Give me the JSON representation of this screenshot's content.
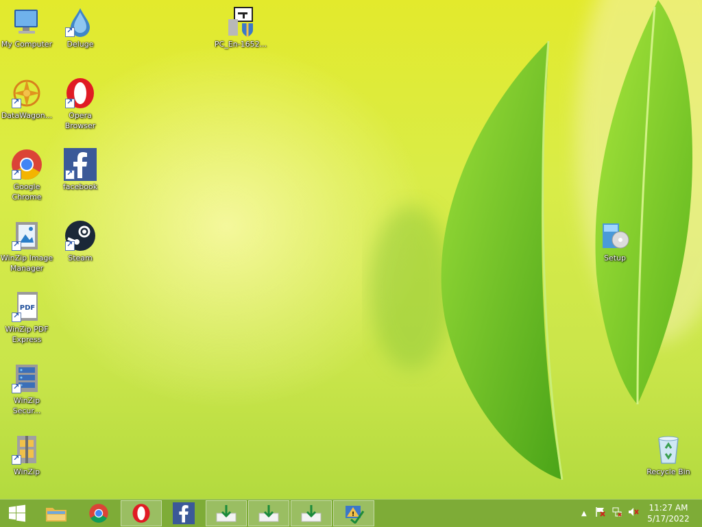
{
  "desktop": {
    "icons_left": [
      {
        "label": "My Computer",
        "icon": "computer-icon"
      },
      {
        "label": "DataWagon...",
        "icon": "datawagon-icon"
      },
      {
        "label": "Google Chrome",
        "icon": "chrome-icon"
      },
      {
        "label": "WinZip Image Manager",
        "icon": "winzip-image-icon"
      },
      {
        "label": "WinZip PDF Express",
        "icon": "winzip-pdf-icon"
      },
      {
        "label": "WinZip Secur...",
        "icon": "winzip-secure-icon"
      },
      {
        "label": "WinZip",
        "icon": "winzip-icon"
      }
    ],
    "icons_col2": [
      {
        "label": "Deluge",
        "icon": "deluge-icon"
      },
      {
        "label": "Opera Browser",
        "icon": "opera-icon"
      },
      {
        "label": "facebook",
        "icon": "facebook-icon"
      },
      {
        "label": "Steam",
        "icon": "steam-icon"
      }
    ],
    "installer": {
      "label": "PC_En-1652...",
      "icon": "installer-icon"
    },
    "setup": {
      "label": "Setup",
      "icon": "setup-icon"
    },
    "recycle_bin": {
      "label": "Recycle Bin",
      "icon": "recycle-bin-icon"
    }
  },
  "taskbar": {
    "items": [
      {
        "name": "start-button",
        "icon": "windows-logo-icon"
      },
      {
        "name": "file-explorer",
        "icon": "folder-icon"
      },
      {
        "name": "chrome",
        "icon": "chrome-icon"
      },
      {
        "name": "opera",
        "icon": "opera-icon"
      },
      {
        "name": "facebook",
        "icon": "facebook-icon"
      },
      {
        "name": "download-1",
        "icon": "download-icon"
      },
      {
        "name": "download-2",
        "icon": "download-icon"
      },
      {
        "name": "download-3",
        "icon": "download-icon"
      },
      {
        "name": "action-center",
        "icon": "warning-check-icon"
      }
    ],
    "clock": {
      "time": "11:27 AM",
      "date": "5/17/2022"
    }
  },
  "colors": {
    "taskbar": "#7aa836",
    "wallpaper_top": "#e3ea2c",
    "leaf": "#7fcc22"
  }
}
